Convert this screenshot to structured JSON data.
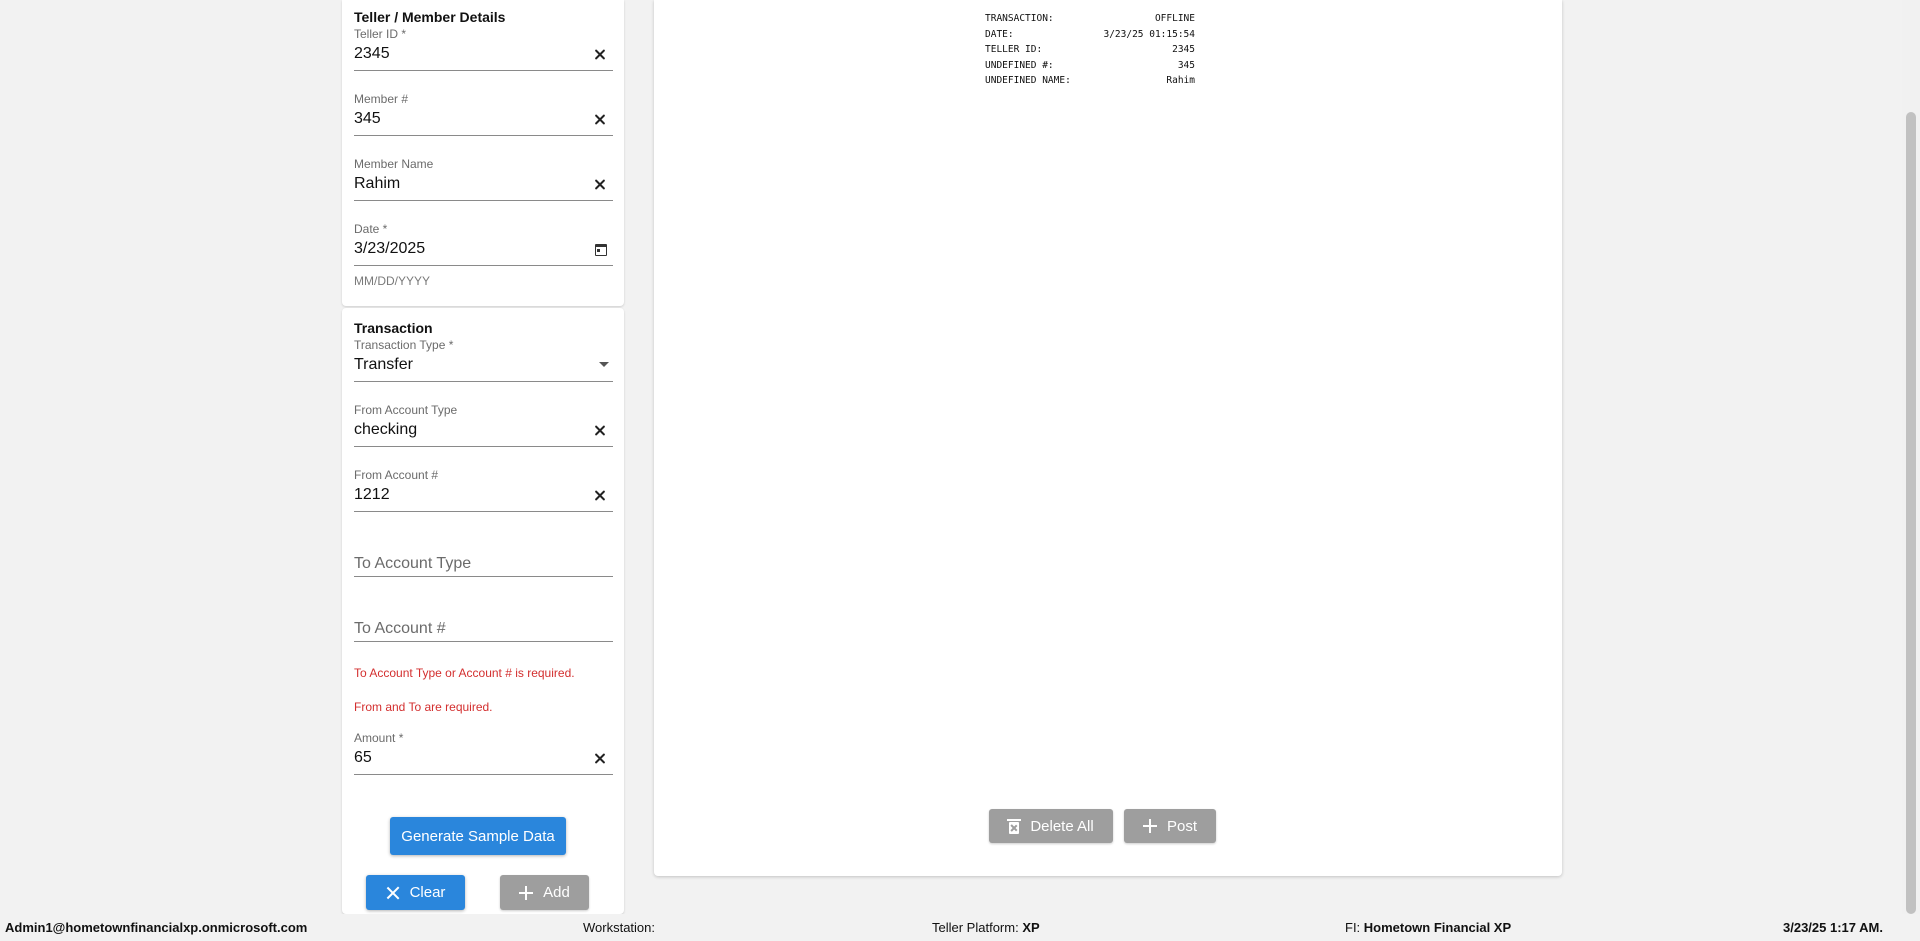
{
  "teller_section": {
    "title": "Teller / Member Details",
    "teller_id": {
      "label": "Teller ID *",
      "value": "2345"
    },
    "member_number": {
      "label": "Member #",
      "value": "345"
    },
    "member_name": {
      "label": "Member Name",
      "value": "Rahim"
    },
    "date": {
      "label": "Date *",
      "value": "3/23/2025",
      "helper": "MM/DD/YYYY"
    }
  },
  "transaction_section": {
    "title": "Transaction",
    "transaction_type": {
      "label": "Transaction Type *",
      "value": "Transfer"
    },
    "from_account_type": {
      "label": "From Account Type",
      "value": "checking"
    },
    "from_account_number": {
      "label": "From Account #",
      "value": "1212"
    },
    "to_account_type": {
      "placeholder": "To Account Type"
    },
    "to_account_number": {
      "placeholder": "To Account #"
    },
    "errors": [
      "To Account Type or Account # is required.",
      "From and To are required."
    ],
    "amount": {
      "label": "Amount *",
      "value": "65"
    }
  },
  "buttons": {
    "generate_sample": "Generate Sample Data",
    "clear": "Clear",
    "add": "Add",
    "delete_all": "Delete All",
    "post": "Post"
  },
  "receipt": [
    {
      "key": "TRANSACTION:",
      "value": "OFFLINE"
    },
    {
      "key": "DATE:",
      "value": "3/23/25 01:15:54"
    },
    {
      "key": "TELLER ID:",
      "value": "2345"
    },
    {
      "key": "UNDEFINED #:",
      "value": "345"
    },
    {
      "key": "UNDEFINED NAME:",
      "value": "Rahim"
    }
  ],
  "status_bar": {
    "user": "Admin1@hometownfinancialxp.onmicrosoft.com",
    "workstation_label": "Workstation:",
    "workstation_value": "",
    "platform_label": "Teller Platform:",
    "platform_value": "XP",
    "fi_label": "FI:",
    "fi_value": "Hometown Financial XP",
    "datetime": "3/23/25 1:17 AM."
  },
  "colors": {
    "primary_button": "#2a86dc",
    "disabled_button": "#9e9e9e",
    "error_text": "#d32f2f"
  },
  "icons": {
    "clear_field": "close-icon",
    "date_picker": "calendar-icon",
    "select": "caret-down-icon",
    "delete_all": "trash-icon",
    "add": "plus-icon"
  }
}
